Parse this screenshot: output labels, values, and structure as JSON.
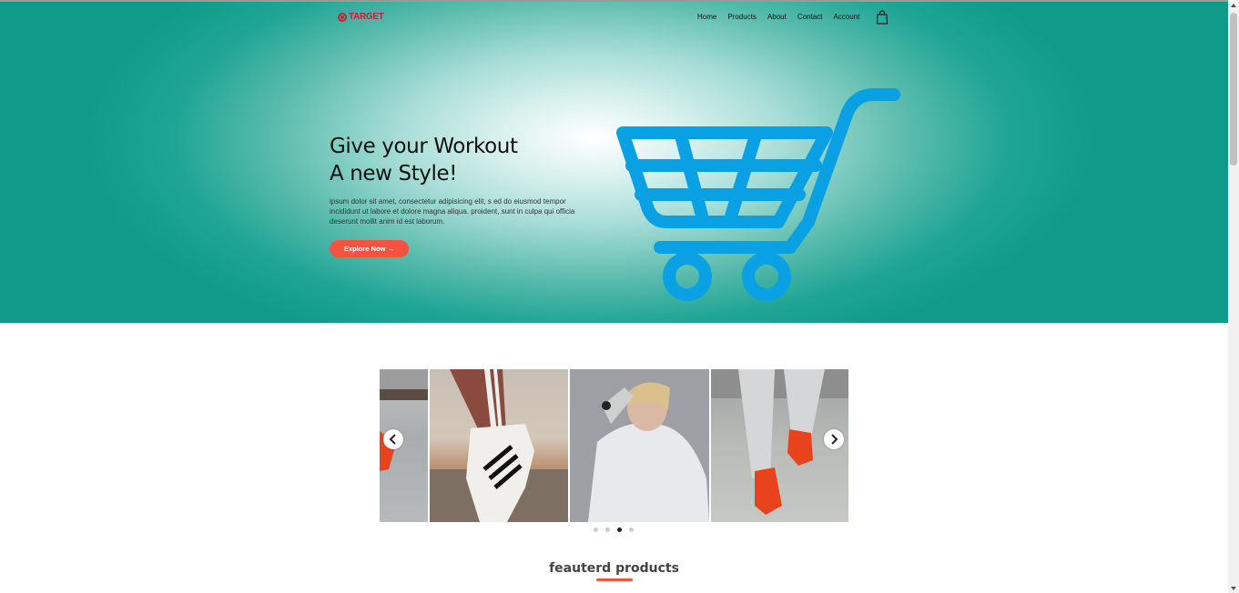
{
  "header": {
    "logo_text": "TARGET",
    "nav": [
      "Home",
      "Products",
      "About",
      "Contact",
      "Account"
    ]
  },
  "hero": {
    "title_line1": "Give your Workout",
    "title_line2": "A new Style!",
    "description": "ipsum dolor sit amet, consectetur adipisicing elit, s ed do eiusmod tempor incididunt ut labore et dolore magna aliqua. proident, sunt in culpa qui officia deserunt mollit anim id est laborum.",
    "button_label": "Explore Now →"
  },
  "carousel": {
    "active_index": 2,
    "dot_count": 4
  },
  "featured": {
    "title": "feauterd products"
  },
  "colors": {
    "accent": "#f4543f",
    "brand": "#cc2030",
    "cart": "#0aa1e4",
    "teal": "#1fa595"
  },
  "icons": [
    "target-logo-icon",
    "shopping-bag-icon",
    "shopping-cart-icon",
    "chevron-left-icon",
    "chevron-right-icon"
  ]
}
